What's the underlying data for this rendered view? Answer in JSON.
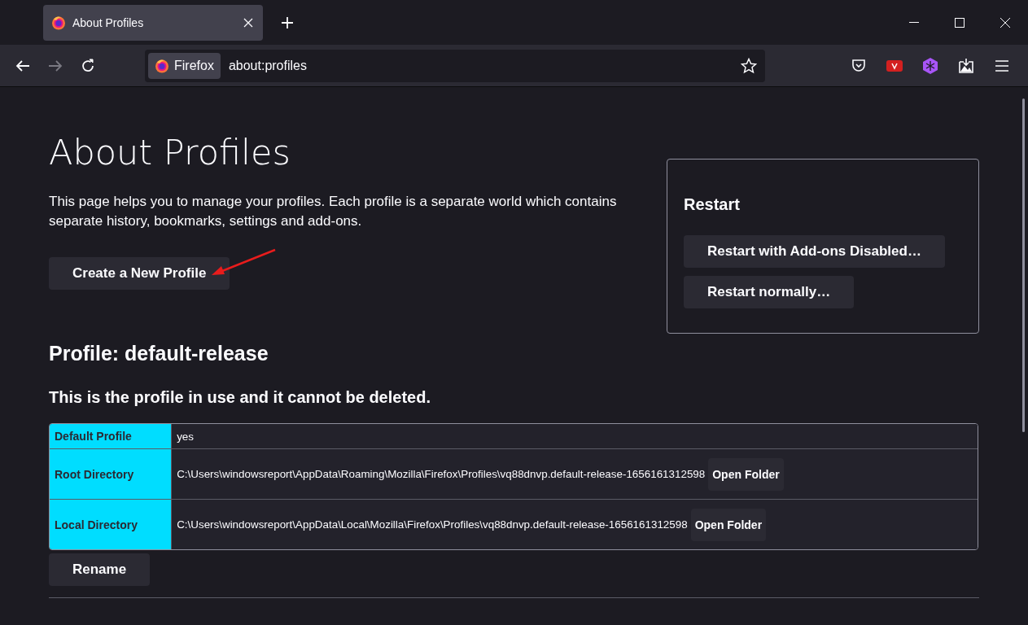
{
  "tabs": [
    {
      "title": "About Profiles",
      "selected": true
    }
  ],
  "toolbar": {
    "identity_label": "Firefox",
    "address": "about:profiles",
    "forward_disabled": true
  },
  "page": {
    "title": "About Profiles",
    "description": "This page helps you to manage your profiles. Each profile is a separate world which contains separate history, bookmarks, settings and add-ons.",
    "create_button": "Create a New Profile",
    "restart_panel": {
      "title": "Restart",
      "buttons": [
        "Restart with Add-ons Disabled…",
        "Restart normally…"
      ]
    },
    "profile": {
      "title": "Profile: default-release",
      "note": "This is the profile in use and it cannot be deleted.",
      "rows": [
        {
          "label": "Default Profile",
          "value": "yes"
        },
        {
          "label": "Root Directory",
          "value": "C:\\Users\\windowsreport\\AppData\\Roaming\\Mozilla\\Firefox\\Profiles\\vq88dnvp.default-release-1656161312598",
          "button": "Open Folder"
        },
        {
          "label": "Local Directory",
          "value": "C:\\Users\\windowsreport\\AppData\\Local\\Mozilla\\Firefox\\Profiles\\vq88dnvp.default-release-1656161312598",
          "button": "Open Folder"
        }
      ],
      "rename_button": "Rename"
    }
  }
}
